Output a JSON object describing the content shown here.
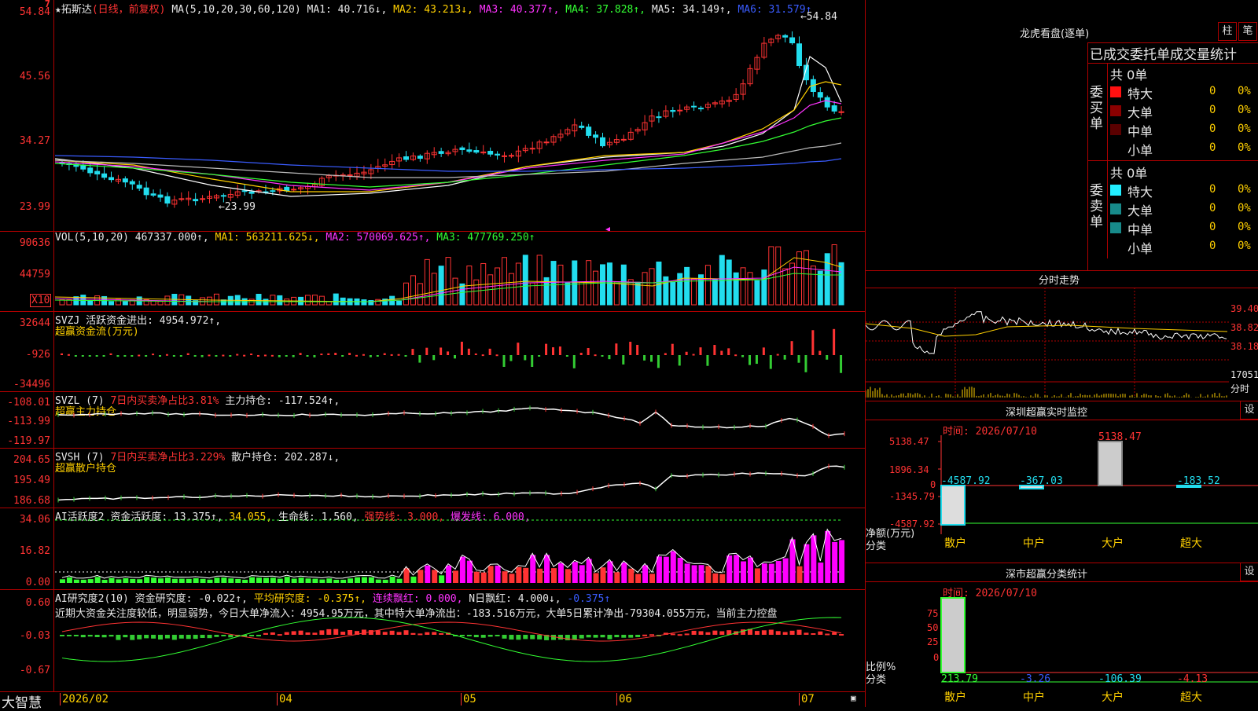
{
  "header": {
    "star": "★",
    "stock_name": "拓斯达",
    "mode": "(日线，前复权)",
    "ma_label": "MA(5,10,20,30,60,120)",
    "ma1": "MA1: 40.716↓,",
    "ma2": "MA2: 43.213↓,",
    "ma3": "MA3: 40.377↑,",
    "ma4": "MA4: 37.828↑,",
    "ma5": "MA5: 34.149↑,",
    "ma6": "MA6: 31.579↑",
    "top_marker": "7"
  },
  "price_panel": {
    "y_labels": [
      "54.84",
      "45.56",
      "34.27",
      "23.99"
    ],
    "high_label": "54.84",
    "low_label": "23.99",
    "high_arrow": "←54.84",
    "low_arrow": "←23.99"
  },
  "vol_panel": {
    "hdr_name": "VOL(5,10,20)",
    "vol": "467337.000↑,",
    "ma1": "MA1: 563211.625↓,",
    "ma2": "MA2: 570069.625↑,",
    "ma3": "MA3: 477769.250↑",
    "y_labels": [
      "90636",
      "44759"
    ],
    "unit": "X10"
  },
  "svzj_panel": {
    "hdr_name": "SVZJ",
    "hdr_text": "活跃资金进出: 4954.972↑,",
    "sub": "超赢资金流(万元)",
    "y_labels": [
      "32644",
      "-926",
      "-34496"
    ]
  },
  "svzl_panel": {
    "hdr_name": "SVZL (7)",
    "hdr_ratio": "7日内买卖净占比3.81%",
    "hdr_text": "主力持仓: -117.524↑,",
    "sub": "超赢主力持仓",
    "y_labels": [
      "-108.01",
      "-113.99",
      "-119.97"
    ]
  },
  "svsh_panel": {
    "hdr_name": "SVSH (7)",
    "hdr_ratio": "7日内买卖净占比3.229%",
    "hdr_text": "散户持仓: 202.287↓,",
    "sub": "超赢散户持仓",
    "y_labels": [
      "204.65",
      "195.49",
      "186.68"
    ]
  },
  "ai_active_panel": {
    "hdr_name": "AI活跃度2",
    "t1": "资金活跃度: 13.375↑,",
    "t2": "34.055,",
    "t3": "生命线: 1.560,",
    "t4": "强势线: 3.000,",
    "t5": "爆发线: 6.000,",
    "y_labels": [
      "34.06",
      "16.82",
      "0.00"
    ]
  },
  "ai_research_panel": {
    "hdr_name": "AI研究度2(10)",
    "t1": "资金研究度: -0.022↑,",
    "t2": "平均研究度: -0.375↑,",
    "t3": "连续飘红: 0.000,",
    "t4": "N日飘红: 4.000↓,",
    "t5": "-0.375↑",
    "comment": "近期大资金关注度较低，明显弱势，今日大单净流入：4954.95万元，其中特大单净流出：-183.516万元，大单5日累计净出-79304.055万元，当前主力控盘",
    "y_labels": [
      "0.60",
      "-0.03",
      "-0.67"
    ]
  },
  "x_axis": {
    "brand": "大智慧",
    "labels": [
      "2026/02",
      "04",
      "05",
      "06",
      "07"
    ]
  },
  "dragon_tiger": {
    "title": "龙虎看盘(逐单)",
    "btn_bar": "柱",
    "btn_pen": "笔",
    "tabs_title": "已成交委托单成交量统计",
    "buy_label": "委买单",
    "sell_label": "委卖单",
    "buy_total": "共 0单",
    "sell_total": "共 0单",
    "rows": [
      "特大",
      "大单",
      "中单",
      "小单"
    ],
    "zero": "0",
    "pct": "0%"
  },
  "intraday": {
    "title": "分时走势",
    "y_labels": [
      "39.40",
      "38.82",
      "38.18"
    ],
    "vol_label": "17051",
    "fen": "分时"
  },
  "sz_monitor": {
    "title": "深圳超赢实时监控",
    "btn": "设",
    "time": "时间: 2026/07/10",
    "y_labels": [
      "5138.47",
      "1896.34",
      "0",
      "-1345.79",
      "-4587.92"
    ],
    "values": [
      "-4587.92",
      "-367.03",
      "5138.47",
      "-183.52"
    ],
    "cats": [
      "散户",
      "中户",
      "大户",
      "超大"
    ],
    "side1": "净额(万元)",
    "side2": "分类",
    "chart_data": {
      "type": "bar",
      "categories": [
        "散户",
        "中户",
        "大户",
        "超大"
      ],
      "values": [
        -4587.92,
        -367.03,
        5138.47,
        -183.52
      ],
      "ylim": [
        -4587.92,
        5138.47
      ]
    }
  },
  "sz_class": {
    "title": "深市超赢分类统计",
    "btn": "设",
    "time": "时间: 2026/07/10",
    "y_labels": [
      "75",
      "50",
      "25",
      "0"
    ],
    "values": [
      "213.79",
      "-3.26",
      "-106.39",
      "-4.13"
    ],
    "cats": [
      "散户",
      "中户",
      "大户",
      "超大"
    ],
    "side1": "比例%",
    "side2": "分类",
    "chart_data": {
      "type": "bar",
      "categories": [
        "散户",
        "中户",
        "大户",
        "超大"
      ],
      "values": [
        213.79,
        -3.26,
        -106.39,
        -4.13
      ],
      "ylim": [
        0,
        75
      ]
    }
  },
  "colors": {
    "up": "#ff3333",
    "down": "#22ddee",
    "border": "#b00000"
  }
}
